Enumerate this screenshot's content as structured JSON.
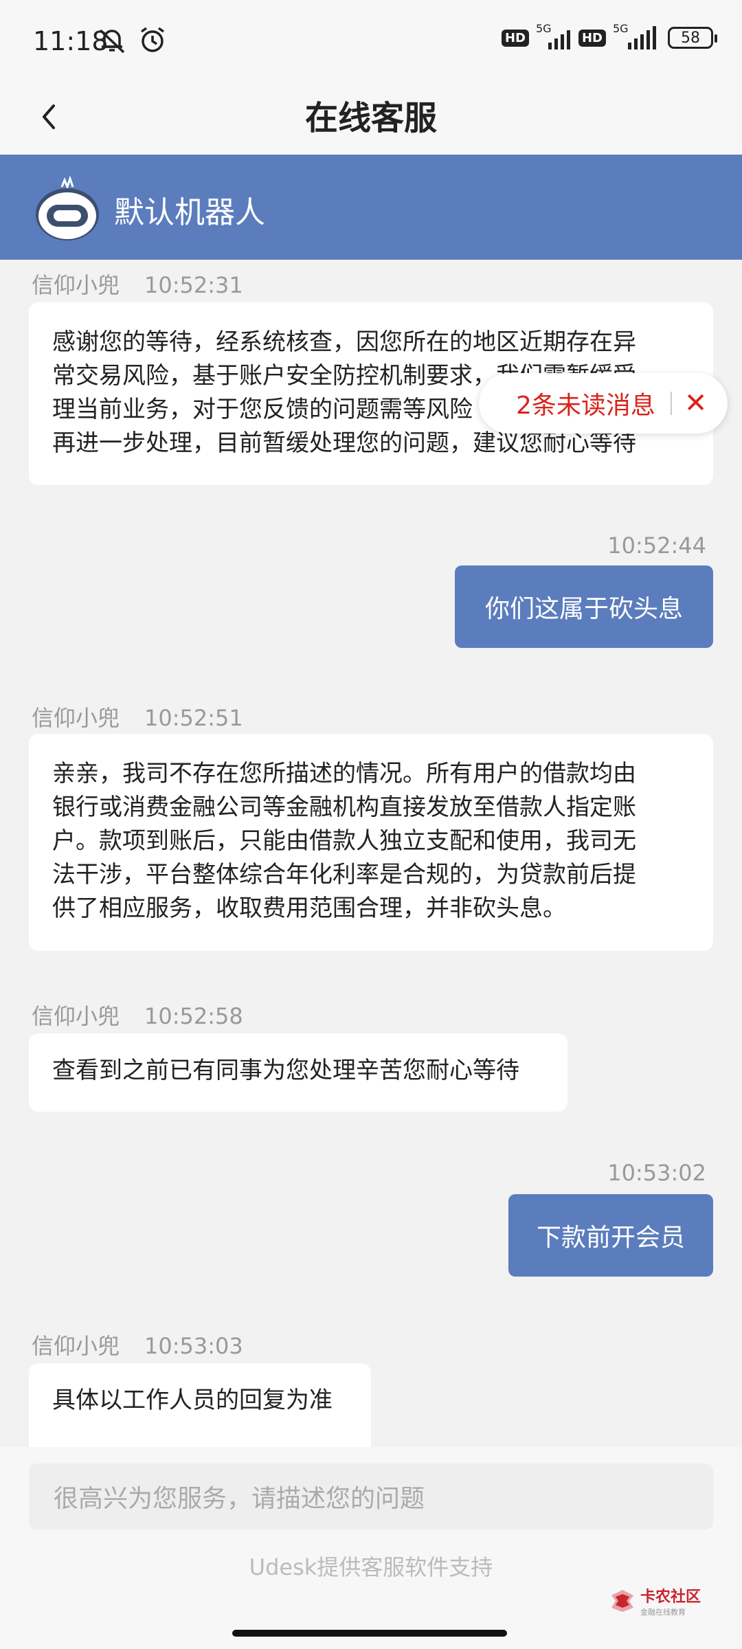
{
  "status_bar": {
    "time": "11:18",
    "network_label_1": "5G",
    "network_label_2": "5G",
    "hd_1": "HD",
    "hd_2": "HD",
    "battery": "58"
  },
  "nav": {
    "title": "在线客服"
  },
  "robot": {
    "name": "默认机器人"
  },
  "messages": [
    {
      "sender": "信仰小兜",
      "time": "10:52:31",
      "lines": [
        "感谢您的等待，经系统核查，因您所在的地区近期存在异",
        "常交易风险，基于账户安全防控机制要求，我们需暂缓受",
        "理当前业务，对于您反馈的问题需等风险",
        "再进一步处理，目前暂缓处理您的问题，建议您耐心等待"
      ]
    },
    {
      "time": "10:52:44",
      "text": "你们这属于砍头息"
    },
    {
      "sender": "信仰小兜",
      "time": "10:52:51",
      "lines": [
        "亲亲，我司不存在您所描述的情况。所有用户的借款均由",
        "银行或消费金融公司等金融机构直接发放至借款人指定账",
        "户。款项到账后，只能由借款人独立支配和使用，我司无",
        "法干涉，平台整体综合年化利率是合规的，为贷款前后提",
        "供了相应服务，收取费用范围合理，并非砍头息。"
      ]
    },
    {
      "sender": "信仰小兜",
      "time": "10:52:58",
      "text": "查看到之前已有同事为您处理辛苦您耐心等待"
    },
    {
      "time": "10:53:02",
      "text": "下款前开会员"
    },
    {
      "sender": "信仰小兜",
      "time": "10:53:03",
      "text": "具体以工作人员的回复为准"
    }
  ],
  "unread": {
    "label": "2条未读消息",
    "close": "✕"
  },
  "input": {
    "placeholder": "很高兴为您服务，请描述您的问题"
  },
  "footer": {
    "powered_by": "Udesk提供客服软件支持"
  },
  "watermark": {
    "main": "卡农社区",
    "sub": "金融在线教育"
  },
  "colors": {
    "accent": "#5b7dbd",
    "unread": "#d9231b",
    "background": "#f2f2f2"
  }
}
